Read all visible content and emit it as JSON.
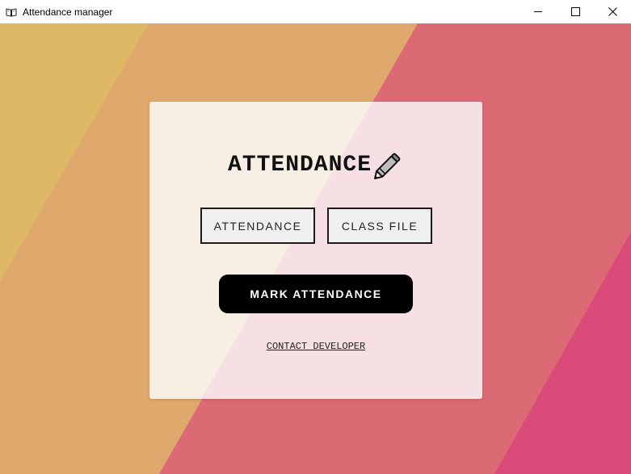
{
  "window": {
    "title": "Attendance manager",
    "icon": "open-book-icon",
    "controls": [
      "minimize-icon",
      "maximize-icon",
      "close-icon"
    ]
  },
  "colors": {
    "stripe_1": "#dfb866",
    "stripe_2": "#dfa86d",
    "stripe_3": "#db6a74",
    "stripe_4": "#db4b79",
    "card_left": "#f8efe4",
    "card_right": "#f6e0e3",
    "button_dark": "#000000",
    "button_light": "#f0f0f0"
  },
  "card": {
    "heading": "ATTENDANCE",
    "heading_icon": "pencil-icon",
    "attendance_button": "ATTENDANCE",
    "class_file_button": "CLASS FILE",
    "mark_button": "MARK ATTENDANCE",
    "contact_link": "CONTACT DEVELOPER"
  }
}
